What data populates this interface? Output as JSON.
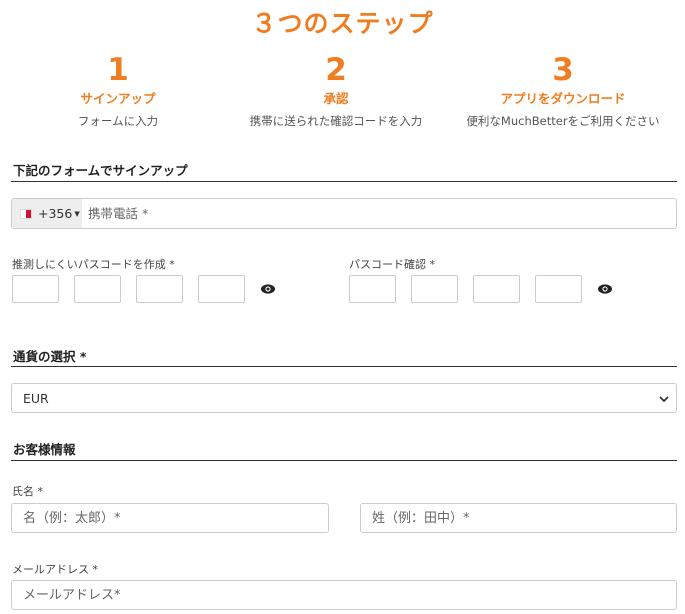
{
  "title": "３つのステップ",
  "steps": [
    {
      "num": "1",
      "label": "サインアップ",
      "desc": "フォームに入力"
    },
    {
      "num": "2",
      "label": "承認",
      "desc": "携帯に送られた確認コードを入力"
    },
    {
      "num": "3",
      "label": "アプリをダウンロード",
      "desc": "便利なMuchBetterをご利用ください"
    }
  ],
  "signup": {
    "section_title": "下記のフォームでサインアップ",
    "phone": {
      "country_code": "+356",
      "placeholder": "携帯電話 *"
    },
    "passcode_label": "推測しにくいパスコードを作成 *",
    "confirm_label": "パスコード確認 *"
  },
  "currency": {
    "section_title": "通貨の選択 *",
    "selected": "EUR"
  },
  "customer": {
    "section_title": "お客様情報",
    "name_label": "氏名 *",
    "first_placeholder": "名（例：太郎）*",
    "last_placeholder": "姓（例：田中）*",
    "email_label": "メールアドレス *",
    "email_placeholder": "メールアドレス*"
  },
  "colors": {
    "accent": "#ef7d22",
    "border": "#cccccc"
  },
  "icons": {
    "show_password": "eye-icon",
    "dropdown": "chevron-down-icon",
    "flag": "malta-flag-icon"
  }
}
